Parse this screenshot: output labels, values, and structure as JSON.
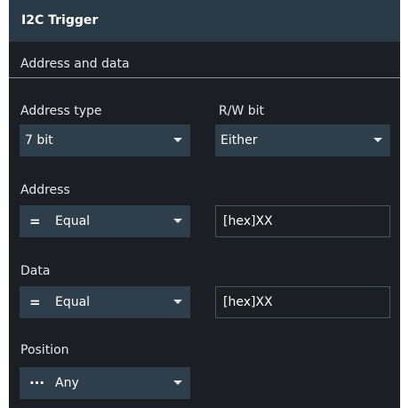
{
  "panel": {
    "title": "I2C Trigger",
    "section_title": "Address and data"
  },
  "address_type": {
    "label": "Address type",
    "value": "7 bit"
  },
  "rw_bit": {
    "label": "R/W bit",
    "value": "Either"
  },
  "address": {
    "label": "Address",
    "condition_symbol": "=",
    "condition": "Equal",
    "value": "[hex]XX"
  },
  "data": {
    "label": "Data",
    "condition_symbol": "=",
    "condition": "Equal",
    "value": "[hex]XX"
  },
  "position": {
    "label": "Position",
    "symbol": "···",
    "value": "Any"
  },
  "colors": {
    "panel_bg": "#1b1e22",
    "header_bg": "#2a3946",
    "control_bg": "#2f3e4b",
    "text": "#e6e8ea"
  }
}
